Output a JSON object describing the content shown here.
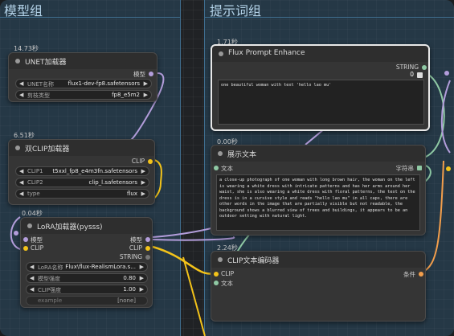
{
  "groups": {
    "left_title": "模型组",
    "right_title": "提示词组"
  },
  "unet": {
    "time": "14.73秒",
    "title": "UNET加载器",
    "output": "模型",
    "unet_name_label": "UNET名称",
    "unet_name_value": "flux1-dev-fp8.safetensors",
    "weight_label": "剪枝类型",
    "weight_value": "fp8_e5m2"
  },
  "dualclip": {
    "time": "6.51秒",
    "title": "双CLIP加载器",
    "output": "CLIP",
    "clip1_label": "CLIP1",
    "clip1_value": "t5xxl_fp8_e4m3fn.safetensors",
    "clip2_label": "CLIP2",
    "clip2_value": "clip_l.safetensors",
    "type_label": "type",
    "type_value": "flux"
  },
  "lora": {
    "time": "0.04秒",
    "title": "LoRA加载器(pysss)",
    "in_model": "模型",
    "in_clip": "CLIP",
    "out_model": "模型",
    "out_clip": "CLIP",
    "out_string": "STRING",
    "lora_label": "LoRA名称",
    "lora_value": "Flux\\flux-RealismLora.s...",
    "model_strength_label": "模型强度",
    "model_strength_value": "0.80",
    "clip_strength_label": "CLIP强度",
    "clip_strength_value": "1.00",
    "example_label": "example",
    "example_value": "[none]"
  },
  "flux_prompt": {
    "time": "1.71秒",
    "title": "Flux Prompt Enhance",
    "output": "STRING",
    "counter": "0",
    "text": "one beautiful woman with text 'hello lao mu'"
  },
  "show_text": {
    "time": "0.00秒",
    "title": "展示文本",
    "input": "文本",
    "output": "字符串",
    "text": "a close-up photograph of one woman with long brown hair, the woman on the left is wearing a white dress with intricate patterns and has her arms around her waist, she is also wearing a white dress with floral patterns, the text on the dress is in a cursive style and reads \"hello lao mu\" in all caps, there are other words in the image that are partially visible but not readable, the background shows a blurred view of trees and buildings, it appears to be an outdoor setting with natural light."
  },
  "clip_encode": {
    "time": "2.24秒",
    "title": "CLIP文本编码器",
    "in_clip": "CLIP",
    "in_text": "文本",
    "output": "条件"
  },
  "colors": {
    "model_wire": "#b39ddb",
    "clip_wire": "#f3c31a",
    "string_wire": "#8fc9a4",
    "cond_wire": "#f29e4c"
  }
}
